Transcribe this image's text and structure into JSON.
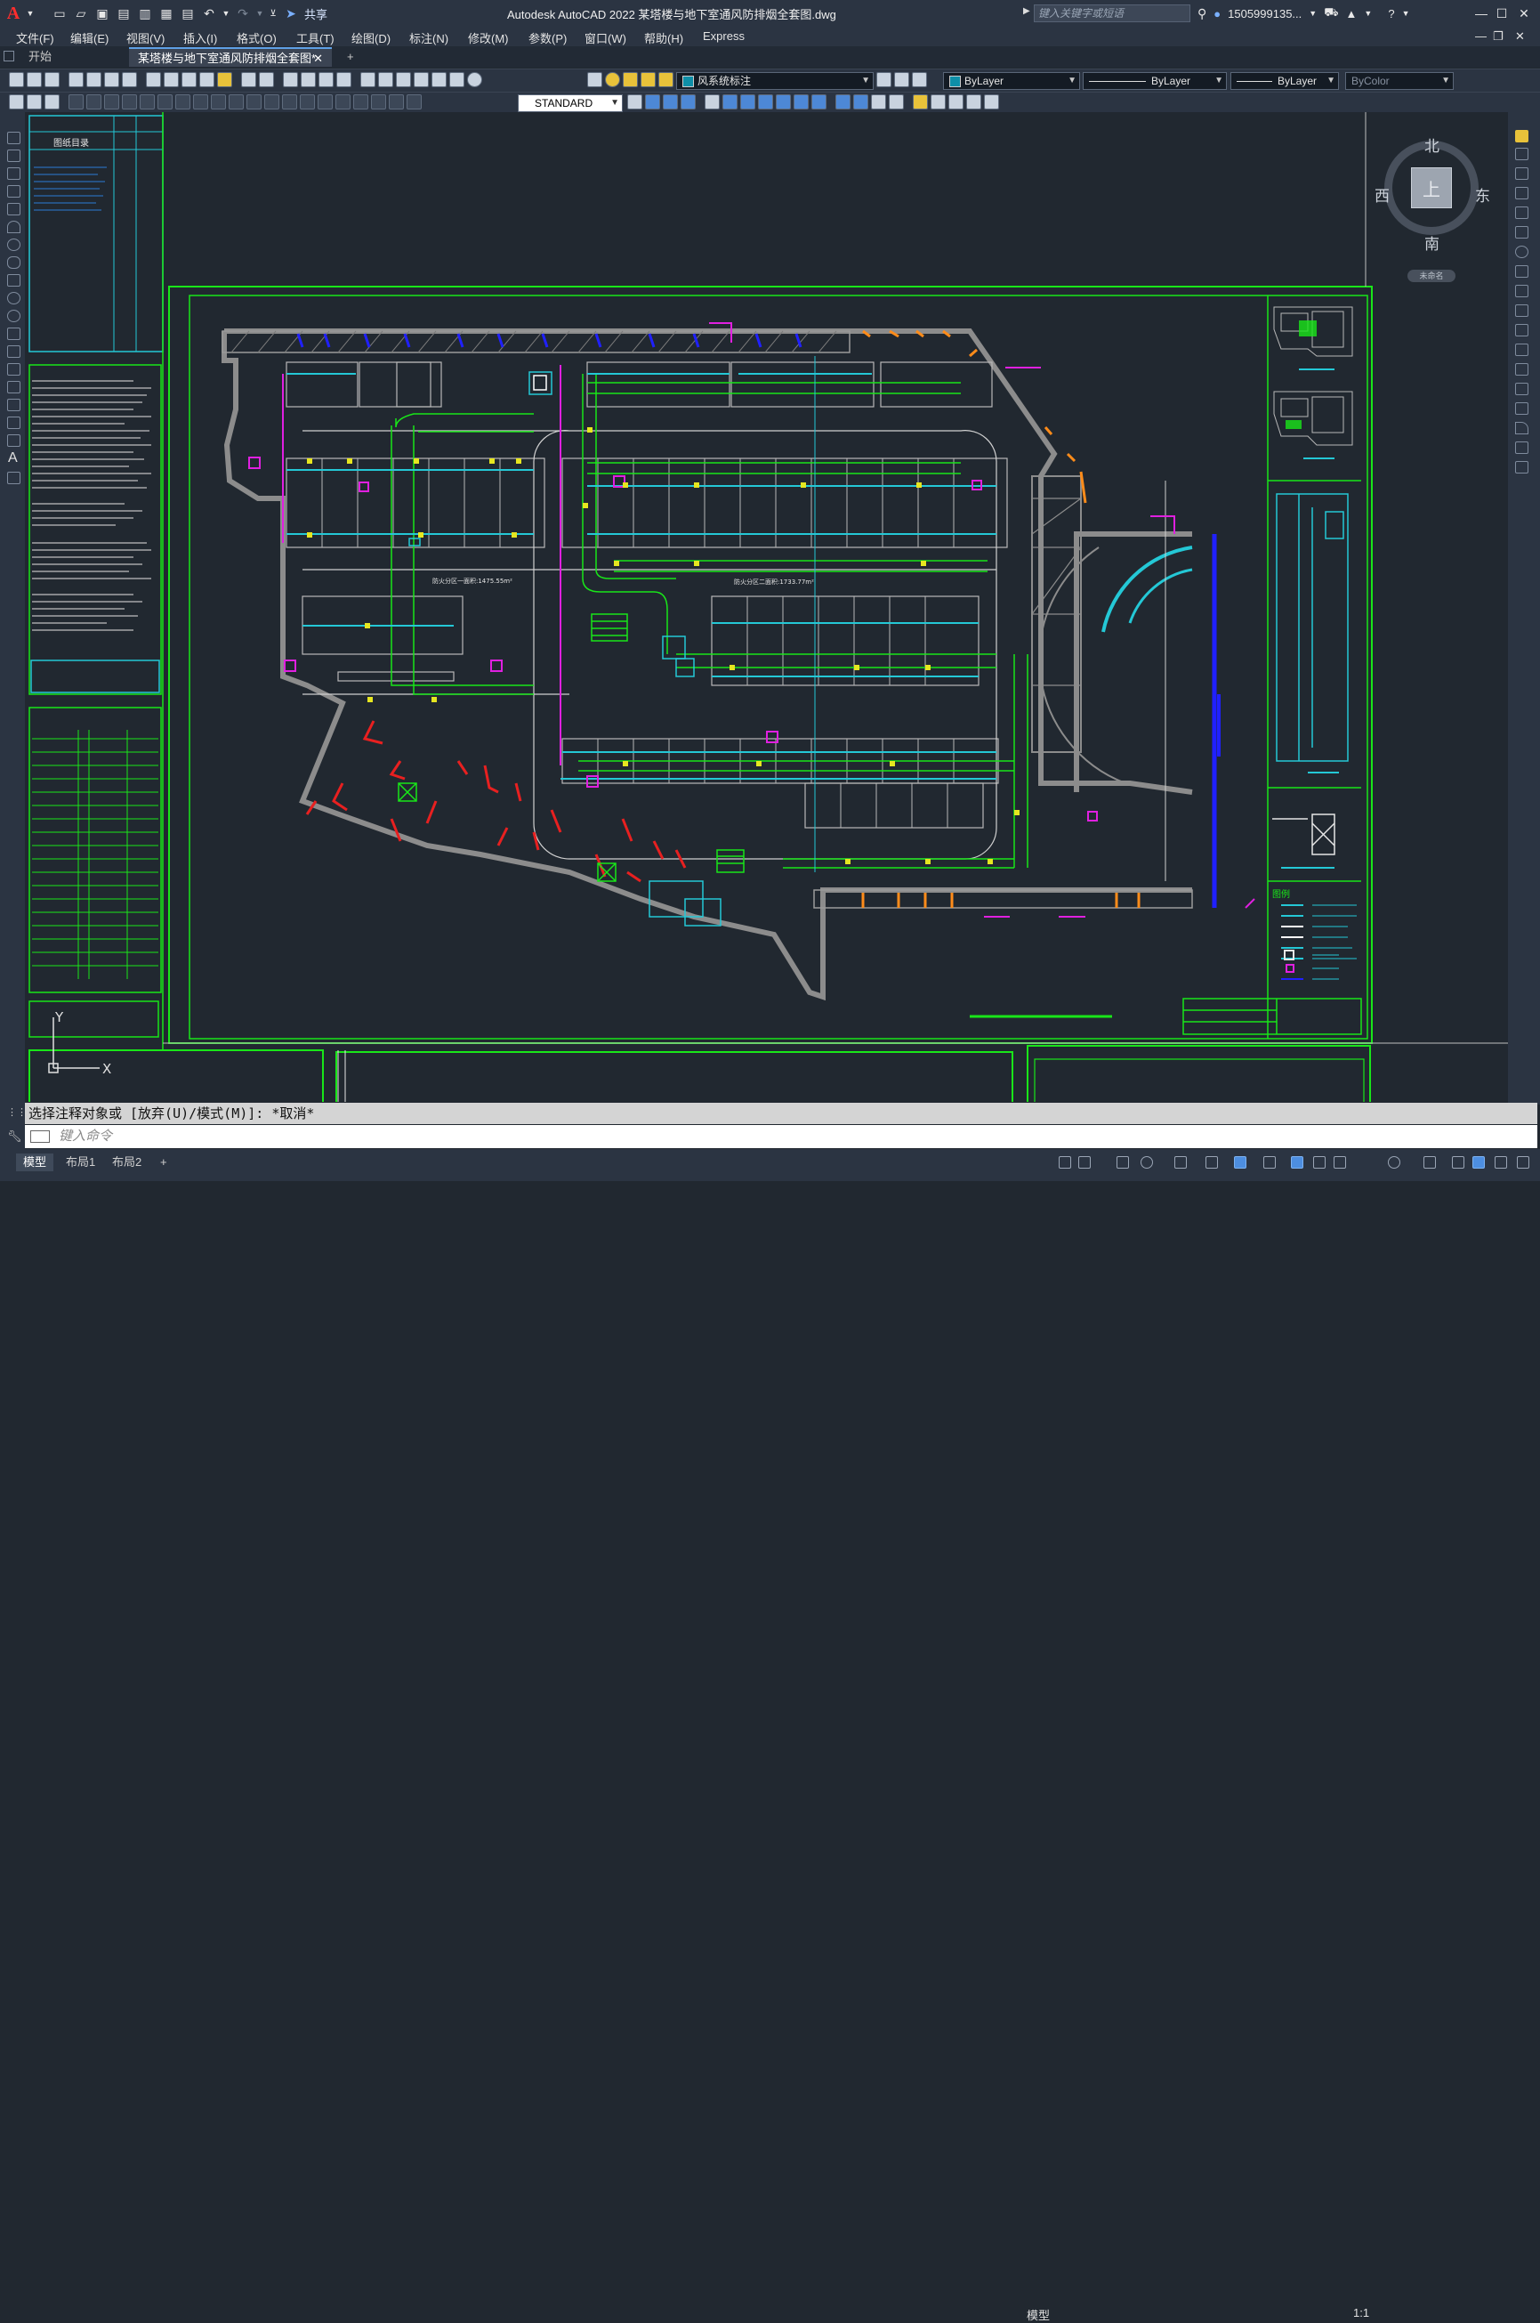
{
  "app": {
    "title": "Autodesk AutoCAD 2022    某塔楼与地下室通风防排烟全套图.dwg",
    "share_label": "共享",
    "search_placeholder": "键入关键字或短语",
    "user": "1505999135...",
    "logo": "A"
  },
  "menu": [
    "文件(F)",
    "编辑(E)",
    "视图(V)",
    "插入(I)",
    "格式(O)",
    "工具(T)",
    "绘图(D)",
    "标注(N)",
    "修改(M)",
    "参数(P)",
    "窗口(W)",
    "帮助(H)",
    "Express"
  ],
  "tabs": {
    "start": "开始",
    "document": "某塔楼与地下室通风防排烟全套图*",
    "add": "+"
  },
  "properties": {
    "layer": "风系统标注",
    "color": "ByLayer",
    "linetype": "ByLayer",
    "lineweight": "ByLayer",
    "plotstyle": "ByColor",
    "textstyle": "STANDARD"
  },
  "viewcube": {
    "north": "北",
    "south": "南",
    "west": "西",
    "east": "东",
    "top": "上",
    "ucs": "未命名"
  },
  "drawing": {
    "area_label_1": "防火分区一面积:1475.55m²",
    "area_label_2": "防火分区二面积:1733.77m²",
    "legend_title": "图例",
    "catalog_title": "图纸目录",
    "ucs_x": "X",
    "ucs_y": "Y"
  },
  "command": {
    "history": "选择注释对象或 [放弃(U)/模式(M)]: *取消*",
    "placeholder": "键入命令"
  },
  "status": {
    "tabs": [
      "模型",
      "布局1",
      "布局2"
    ],
    "add": "+",
    "model_space": "模型",
    "scale": "1:1"
  },
  "colors": {
    "accent": "#5fa0e6",
    "wall": "#8c8c8c",
    "frame_green": "#19e619",
    "duct_cyan": "#24c8d6",
    "blue": "#2020ff",
    "magenta": "#e020e0",
    "red": "#e82020",
    "yellow": "#e6e620",
    "orange": "#ff8c1a"
  }
}
